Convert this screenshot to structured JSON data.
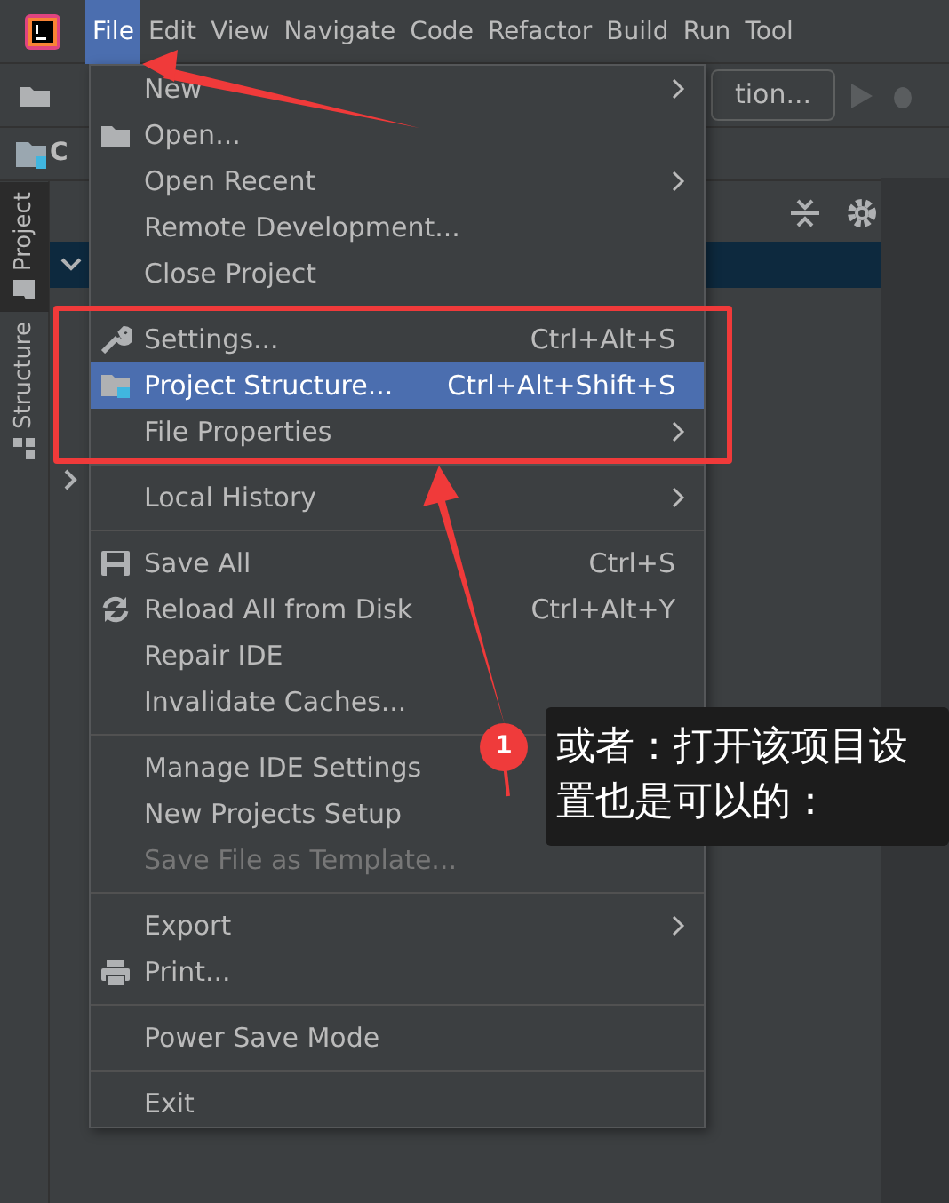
{
  "menu_bar": [
    {
      "label": "File",
      "selected": true
    },
    {
      "label": "Edit",
      "selected": false
    },
    {
      "label": "View",
      "selected": false
    },
    {
      "label": "Navigate",
      "selected": false
    },
    {
      "label": "Code",
      "selected": false
    },
    {
      "label": "Refactor",
      "selected": false
    },
    {
      "label": "Build",
      "selected": false
    },
    {
      "label": "Run",
      "selected": false
    },
    {
      "label": "Tool",
      "selected": false
    }
  ],
  "toolbar": {
    "run_config": "tion..."
  },
  "breadcrumb": "C",
  "side_tabs": [
    {
      "label": "Project",
      "selected": true
    },
    {
      "label": "Structure",
      "selected": false
    }
  ],
  "file_menu": [
    [
      {
        "label": "New",
        "submenu": true,
        "selected": false,
        "disabled": false
      },
      {
        "label": "Open...",
        "submenu": false,
        "selected": false,
        "disabled": false
      },
      {
        "label": "Open Recent",
        "submenu": true,
        "selected": false,
        "disabled": false
      },
      {
        "label": "Remote Development...",
        "submenu": false,
        "selected": false,
        "disabled": false
      },
      {
        "label": "Close Project",
        "submenu": false,
        "selected": false,
        "disabled": false
      }
    ],
    [
      {
        "label": "Settings...",
        "shortcut": "Ctrl+Alt+S",
        "submenu": false,
        "selected": false,
        "disabled": false
      },
      {
        "label": "Project Structure...",
        "shortcut": "Ctrl+Alt+Shift+S",
        "submenu": false,
        "selected": true,
        "disabled": false
      },
      {
        "label": "File Properties",
        "submenu": true,
        "selected": false,
        "disabled": false
      }
    ],
    [
      {
        "label": "Local History",
        "submenu": true,
        "selected": false,
        "disabled": false
      }
    ],
    [
      {
        "label": "Save All",
        "shortcut": "Ctrl+S",
        "submenu": false,
        "selected": false,
        "disabled": false
      },
      {
        "label": "Reload All from Disk",
        "shortcut": "Ctrl+Alt+Y",
        "submenu": false,
        "selected": false,
        "disabled": false
      },
      {
        "label": "Repair IDE",
        "submenu": false,
        "selected": false,
        "disabled": false
      },
      {
        "label": "Invalidate Caches...",
        "submenu": false,
        "selected": false,
        "disabled": false
      }
    ],
    [
      {
        "label": "Manage IDE Settings",
        "selected": false,
        "disabled": false
      },
      {
        "label": "New Projects Setup",
        "selected": false,
        "disabled": false
      },
      {
        "label": "Save File as Template...",
        "submenu": false,
        "selected": false,
        "disabled": true
      }
    ],
    [
      {
        "label": "Export",
        "submenu": true,
        "selected": false,
        "disabled": false
      },
      {
        "label": "Print...",
        "submenu": false,
        "selected": false,
        "disabled": false
      }
    ],
    [
      {
        "label": "Power Save Mode",
        "submenu": false,
        "selected": false,
        "disabled": false
      }
    ],
    [
      {
        "label": "Exit",
        "submenu": false,
        "selected": false,
        "disabled": false
      }
    ]
  ],
  "callout": {
    "badge": "1",
    "text": "或者：打开该项目设置也是可以的："
  }
}
